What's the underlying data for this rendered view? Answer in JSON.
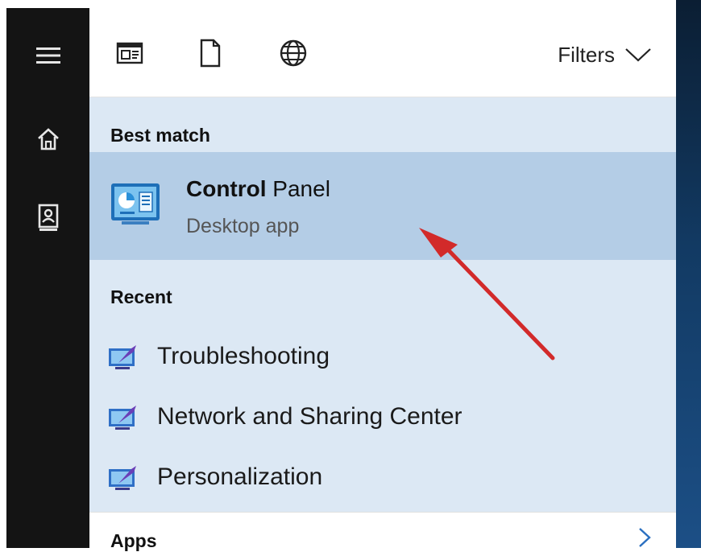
{
  "toolbar": {
    "icons": [
      "apps-icon",
      "documents-icon",
      "web-icon"
    ],
    "filters_label": "Filters"
  },
  "sidebar": {
    "icons": [
      "hamburger-menu-icon",
      "home-icon",
      "notebook-icon"
    ]
  },
  "best_match": {
    "heading": "Best match",
    "app_name_bold": "Control",
    "app_name_rest": " Panel",
    "app_type": "Desktop app",
    "icon": "control-panel-icon"
  },
  "recent": {
    "heading": "Recent",
    "items": [
      {
        "label": "Troubleshooting",
        "icon": "control-panel-item-icon"
      },
      {
        "label": "Network and Sharing Center",
        "icon": "control-panel-item-icon"
      },
      {
        "label": "Personalization",
        "icon": "control-panel-item-icon"
      }
    ]
  },
  "apps": {
    "heading": "Apps"
  },
  "colors": {
    "sidebar": "#141414",
    "results_bg": "#dce8f4",
    "highlight": "#b4cde6",
    "annotation_arrow": "#d22a2a"
  }
}
